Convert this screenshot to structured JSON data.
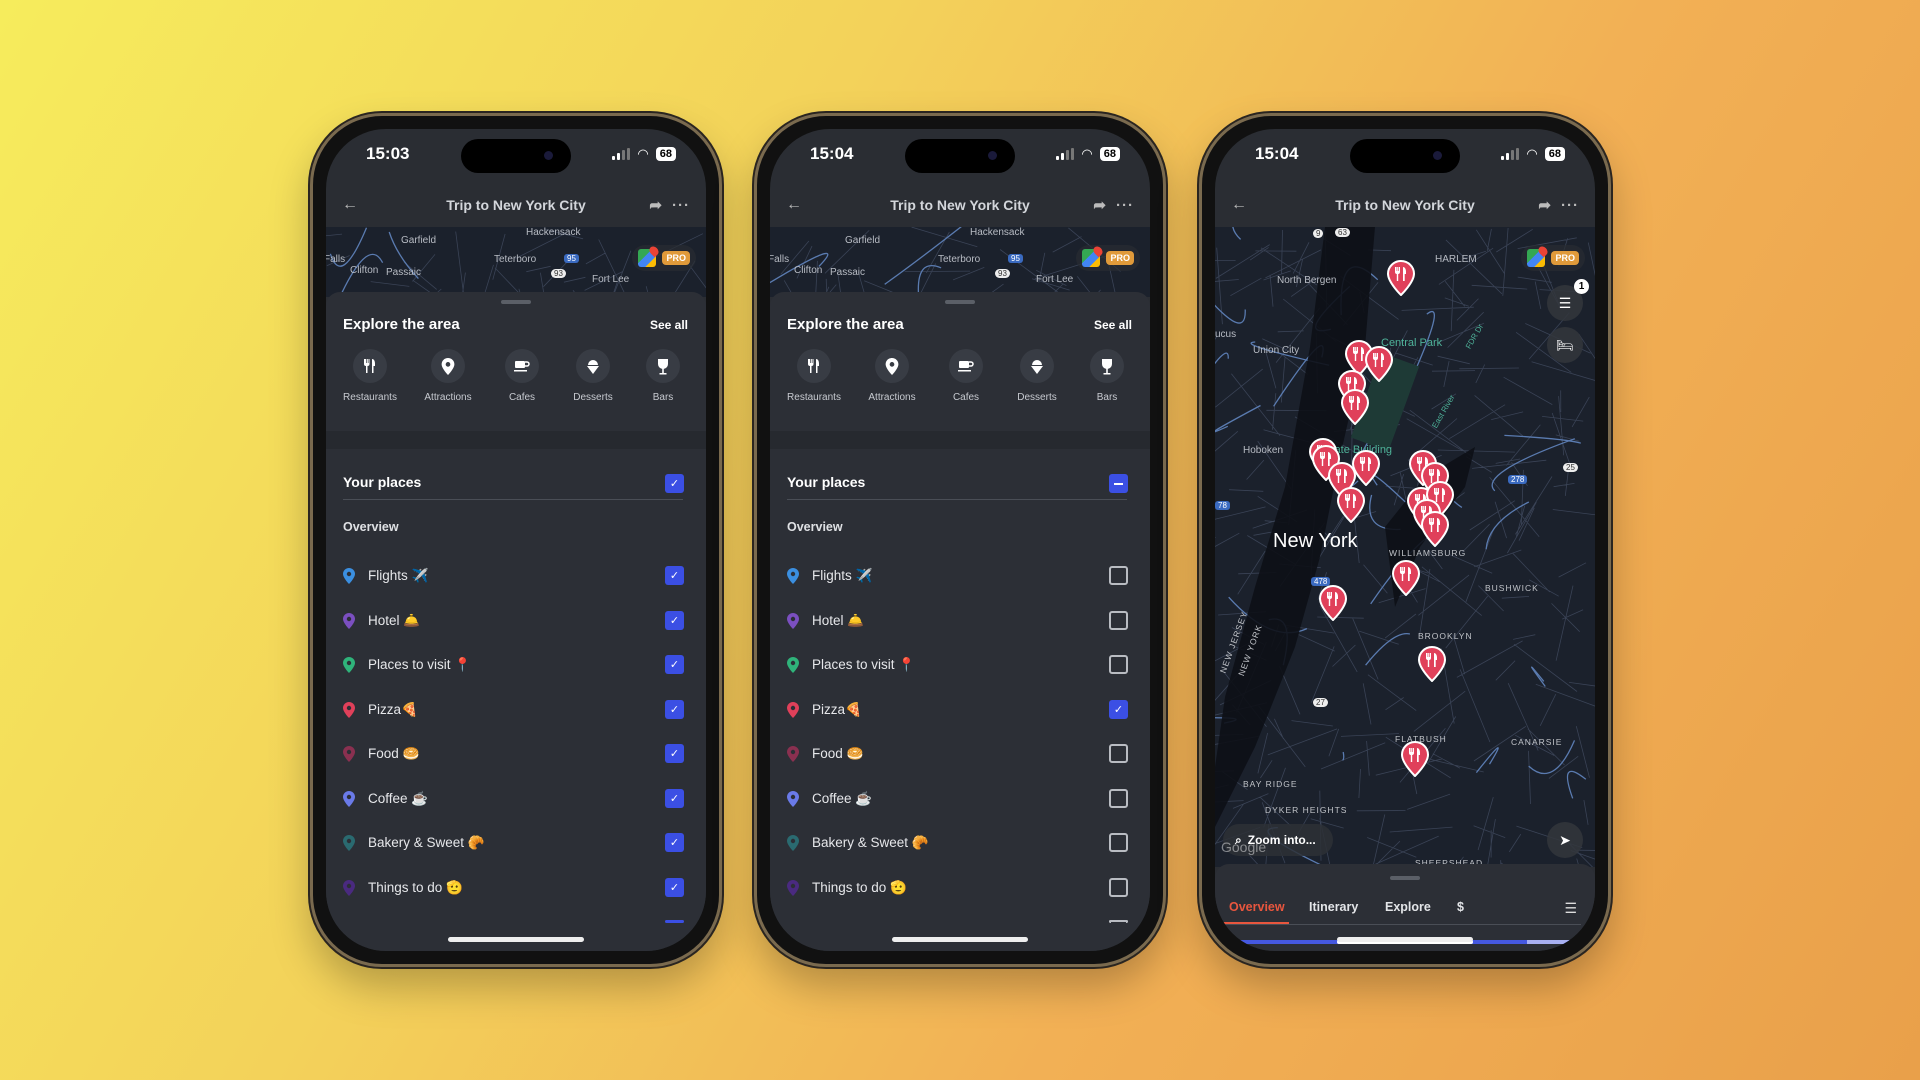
{
  "colors": {
    "checkbox": "#3b4fe4",
    "active_tab": "#e8563e",
    "marker": "#e0405a",
    "pro_badge": "#e09a3a"
  },
  "phones": [
    {
      "status": {
        "time": "15:03",
        "battery": "68"
      },
      "header": {
        "title": "Trip to New York City"
      },
      "map": {
        "labels": [
          "Hackensack",
          "Garfield",
          "Teterboro",
          "Falls",
          "Clifton",
          "Passaic",
          "Fort Lee"
        ],
        "shields": [
          "95",
          "93"
        ],
        "pro": "PRO"
      },
      "explore": {
        "title": "Explore the area",
        "see_all": "See all",
        "categories": [
          {
            "label": "Restaurants",
            "icon": "fork-knife-icon"
          },
          {
            "label": "Attractions",
            "icon": "map-pin-icon"
          },
          {
            "label": "Cafes",
            "icon": "coffee-cup-icon"
          },
          {
            "label": "Desserts",
            "icon": "ice-cream-icon"
          },
          {
            "label": "Bars",
            "icon": "wine-glass-icon"
          }
        ]
      },
      "your_places": {
        "title": "Your places",
        "state": "checked"
      },
      "overview_label": "Overview",
      "lists": [
        {
          "label": "Flights ✈️",
          "pin_color": "#3b8fe0",
          "checked": true
        },
        {
          "label": "Hotel 🛎️",
          "pin_color": "#7b4fc0",
          "checked": true
        },
        {
          "label": "Places to visit 📍",
          "pin_color": "#2fb37a",
          "checked": true
        },
        {
          "label": "Pizza🍕",
          "pin_color": "#e0405a",
          "checked": true
        },
        {
          "label": "Food 🥯",
          "pin_color": "#8a3050",
          "checked": true
        },
        {
          "label": "Coffee ☕",
          "pin_color": "#6a7ae8",
          "checked": true
        },
        {
          "label": "Bakery & Sweet 🥐",
          "pin_color": "#2a6a70",
          "checked": true
        },
        {
          "label": "Things to do 🫡",
          "pin_color": "#4a2a80",
          "checked": true
        }
      ]
    },
    {
      "status": {
        "time": "15:04",
        "battery": "68"
      },
      "header": {
        "title": "Trip to New York City"
      },
      "map": {
        "labels": [
          "Hackensack",
          "Garfield",
          "Teterboro",
          "Falls",
          "Clifton",
          "Passaic",
          "Fort Lee"
        ],
        "shields": [
          "95",
          "93"
        ],
        "pro": "PRO"
      },
      "explore": {
        "title": "Explore the area",
        "see_all": "See all",
        "categories": [
          {
            "label": "Restaurants",
            "icon": "fork-knife-icon"
          },
          {
            "label": "Attractions",
            "icon": "map-pin-icon"
          },
          {
            "label": "Cafes",
            "icon": "coffee-cup-icon"
          },
          {
            "label": "Desserts",
            "icon": "ice-cream-icon"
          },
          {
            "label": "Bars",
            "icon": "wine-glass-icon"
          }
        ]
      },
      "your_places": {
        "title": "Your places",
        "state": "mixed"
      },
      "overview_label": "Overview",
      "lists": [
        {
          "label": "Flights ✈️",
          "pin_color": "#3b8fe0",
          "checked": false
        },
        {
          "label": "Hotel 🛎️",
          "pin_color": "#7b4fc0",
          "checked": false
        },
        {
          "label": "Places to visit 📍",
          "pin_color": "#2fb37a",
          "checked": false
        },
        {
          "label": "Pizza🍕",
          "pin_color": "#e0405a",
          "checked": true
        },
        {
          "label": "Food 🥯",
          "pin_color": "#8a3050",
          "checked": false
        },
        {
          "label": "Coffee ☕",
          "pin_color": "#6a7ae8",
          "checked": false
        },
        {
          "label": "Bakery & Sweet 🥐",
          "pin_color": "#2a6a70",
          "checked": false
        },
        {
          "label": "Things to do 🫡",
          "pin_color": "#4a2a80",
          "checked": false
        }
      ]
    },
    {
      "status": {
        "time": "15:04",
        "battery": "68"
      },
      "header": {
        "title": "Trip to New York City"
      },
      "map": {
        "labels": [
          "HARLEM",
          "North Bergen",
          "Central Park",
          "Union City",
          "Hoboken",
          "e State Building",
          "New York",
          "WILLIAMSBURG",
          "BUSHWICK",
          "BROOKLYN",
          "FLATBUSH",
          "CANARSIE",
          "BAY RIDGE",
          "DYKER HEIGHTS",
          "SHEEPSHEAD",
          "NEW JERSEY",
          "NEW YORK",
          "ucus",
          "FDR Dr",
          "East River"
        ],
        "shields": [
          "9",
          "63",
          "278",
          "478",
          "27",
          "25",
          "78"
        ],
        "pro": "PRO",
        "layers_badge": "1",
        "zoom_button": "Zoom into...",
        "attribution": "Google",
        "marker_icon": "fork-knife-icon"
      },
      "tabs": [
        {
          "label": "Overview",
          "active": true
        },
        {
          "label": "Itinerary"
        },
        {
          "label": "Explore"
        },
        {
          "label": "$"
        }
      ]
    }
  ]
}
